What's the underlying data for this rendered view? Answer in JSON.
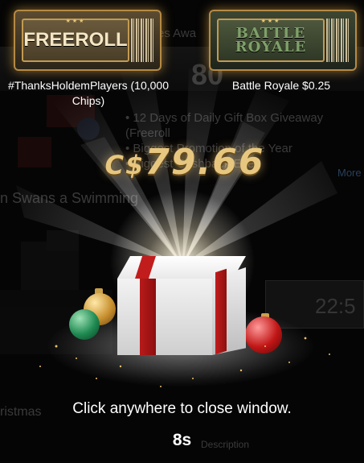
{
  "background": {
    "heading_partial": "es Awa",
    "big_number_partial": "80",
    "bullets": [
      "12 Days of Daily Gift Box Giveaway (Freeroll",
      "Biggest Promotion of the Year",
      "Biggest Cashback Ever"
    ],
    "swans_text": "n Swans a Swimming",
    "more_text": "More",
    "timer_partial": "22:5",
    "christmas_partial": "ristmas",
    "table_header": "Description"
  },
  "tickets": [
    {
      "word": "FREEROLL",
      "caption": "#ThanksHoldemPlayers (10,000 Chips)"
    },
    {
      "word_line1": "BATTLE",
      "word_line2": "ROYALE",
      "caption": "Battle Royale $0.25"
    }
  ],
  "prize": {
    "currency": "C$",
    "amount": "79.66"
  },
  "close_message": "Click anywhere to close window.",
  "countdown": "8s",
  "colors": {
    "gold": "#e7c77f",
    "ribbon": "#b81a1a",
    "ornament_red": "#c01616",
    "ornament_green": "#1f8a52"
  }
}
